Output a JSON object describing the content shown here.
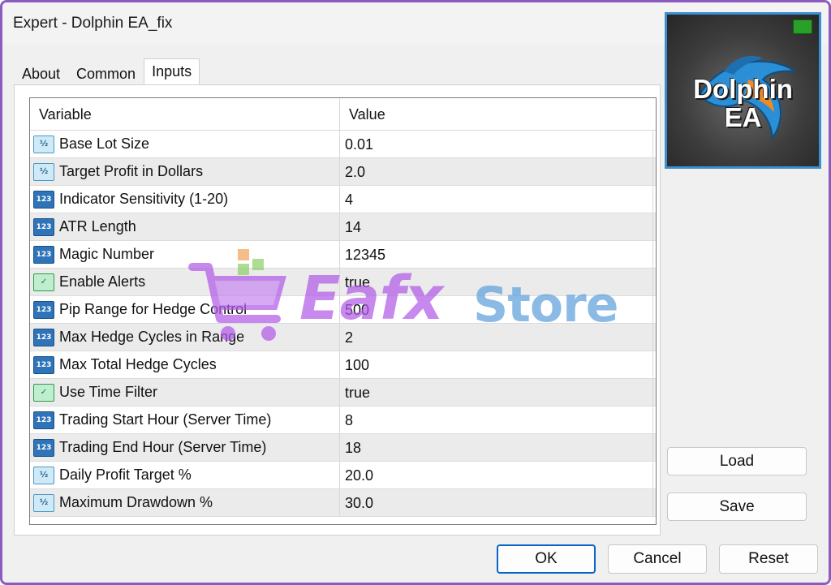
{
  "window": {
    "title": "Expert - Dolphin EA_fix"
  },
  "tabs": [
    {
      "label": "About"
    },
    {
      "label": "Common"
    },
    {
      "label": "Inputs",
      "active": true
    }
  ],
  "grid": {
    "header": {
      "variable": "Variable",
      "value": "Value"
    },
    "rows": [
      {
        "icon": "double-icon",
        "variable": "Base Lot Size",
        "value": "0.01"
      },
      {
        "icon": "double-icon",
        "variable": "Target Profit in Dollars",
        "value": "2.0"
      },
      {
        "icon": "integer-icon",
        "variable": "Indicator Sensitivity (1-20)",
        "value": "4"
      },
      {
        "icon": "integer-icon",
        "variable": "ATR Length",
        "value": "14"
      },
      {
        "icon": "integer-icon",
        "variable": "Magic Number",
        "value": "12345"
      },
      {
        "icon": "boolean-icon",
        "variable": "Enable Alerts",
        "value": "true"
      },
      {
        "icon": "integer-icon",
        "variable": "Pip Range for Hedge Control",
        "value": "500"
      },
      {
        "icon": "integer-icon",
        "variable": "Max Hedge Cycles in Range",
        "value": "2"
      },
      {
        "icon": "integer-icon",
        "variable": "Max Total Hedge Cycles",
        "value": "100"
      },
      {
        "icon": "boolean-icon",
        "variable": "Use Time Filter",
        "value": "true"
      },
      {
        "icon": "integer-icon",
        "variable": "Trading Start Hour (Server Time)",
        "value": "8"
      },
      {
        "icon": "integer-icon",
        "variable": "Trading End Hour (Server Time)",
        "value": "18"
      },
      {
        "icon": "double-icon",
        "variable": "Daily Profit Target %",
        "value": "20.0"
      },
      {
        "icon": "double-icon",
        "variable": "Maximum Drawdown %",
        "value": "30.0"
      }
    ],
    "icon_glyphs": {
      "double": "½",
      "integer": "123",
      "boolean": "✓"
    }
  },
  "logo": {
    "line1": "Dolphin",
    "line2": "EA"
  },
  "side_buttons": {
    "load": "Load",
    "save": "Save"
  },
  "footer_buttons": {
    "ok": "OK",
    "cancel": "Cancel",
    "reset": "Reset"
  },
  "watermark": {
    "part1": "Eafx",
    "part2": "Store"
  },
  "colors": {
    "accent_border": "#8a5cc0",
    "ok_border": "#0a64c8",
    "watermark_purple": "#b25ce8",
    "watermark_blue": "#5fa2dc"
  }
}
